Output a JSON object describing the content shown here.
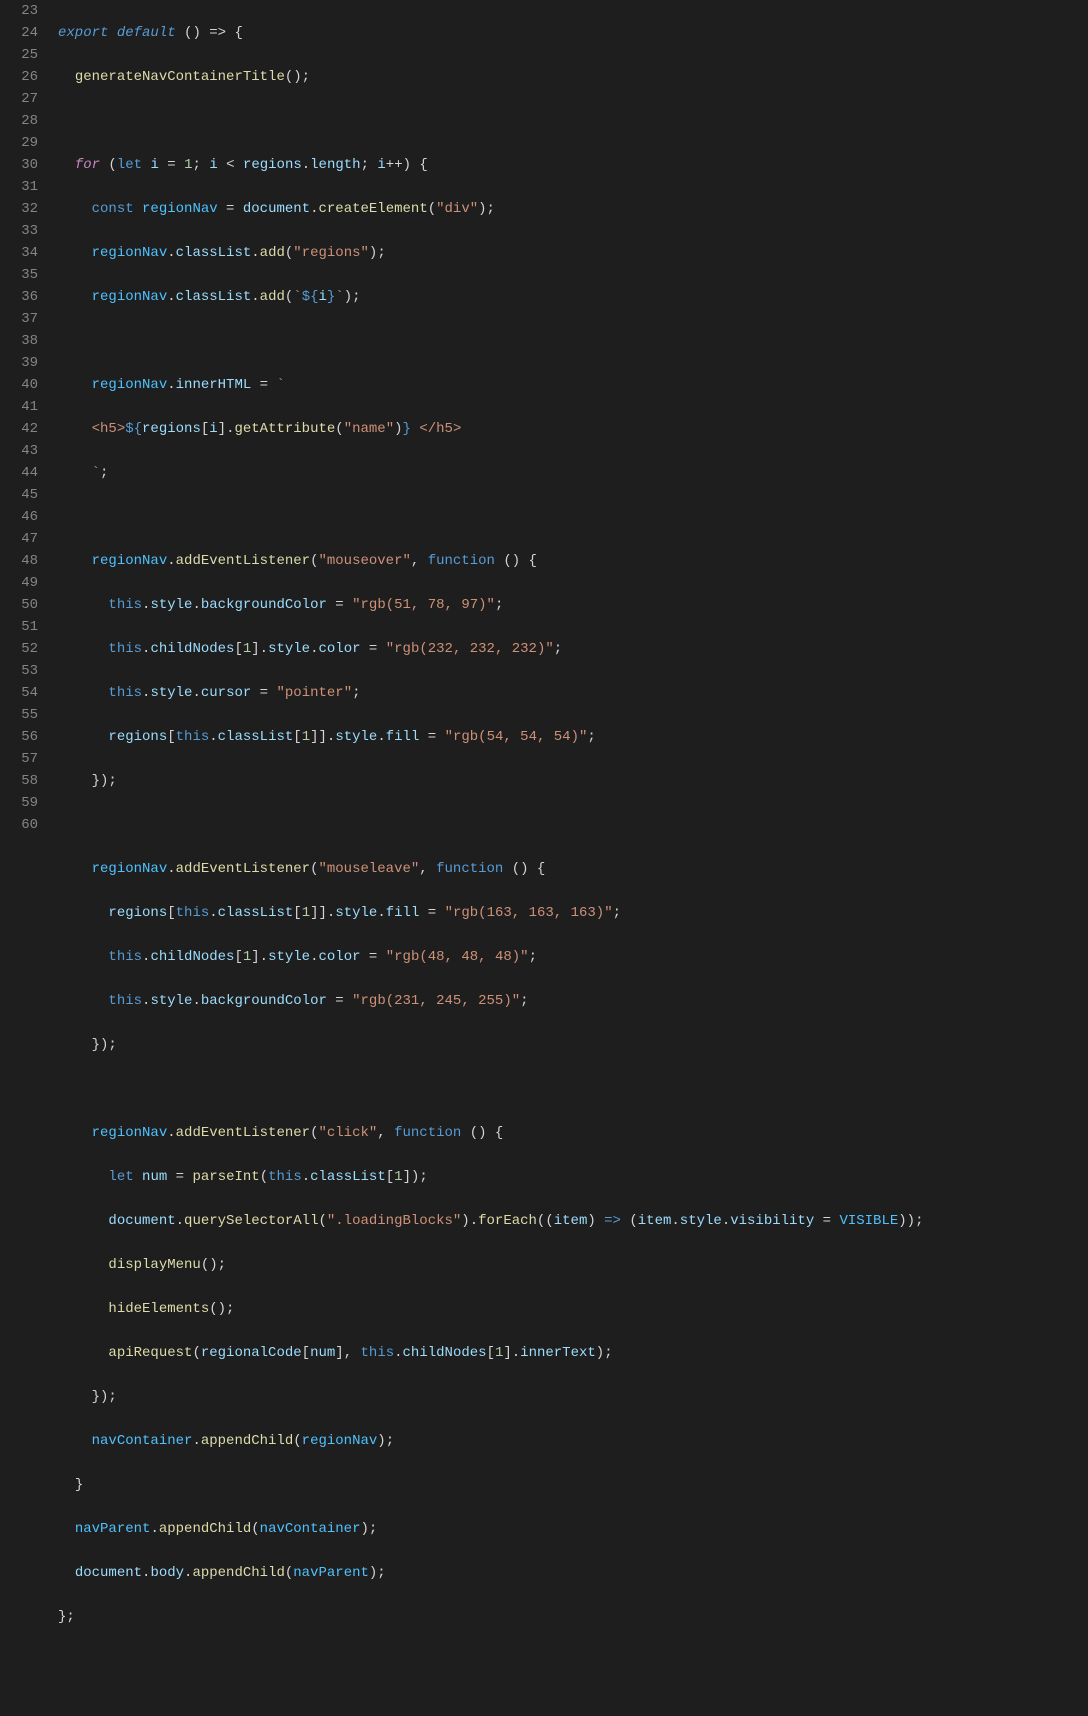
{
  "lineStart": 23,
  "lineEnd": 60,
  "code": {
    "l23": {
      "kw_export": "export",
      "kw_default": "default",
      "arrow": "() => {"
    },
    "l24": {
      "fn": "generateNavContainerTitle",
      "suffix": "();"
    },
    "l26": {
      "for": "for",
      "open": " (",
      "let": "let",
      "i": " i ",
      "eq": "= ",
      "one": "1",
      "semi1": "; ",
      "i2": "i ",
      "lt": "< ",
      "regions": "regions",
      "dot": ".",
      "length": "length",
      "semi2": "; ",
      "i3": "i",
      "pp": "++",
      "close": ") {"
    },
    "l27": {
      "const": "const",
      "sp": " ",
      "regionNav": "regionNav",
      "eq": " = ",
      "document": "document",
      "dot": ".",
      "create": "createElement",
      "open": "(",
      "str": "\"div\"",
      "close": ");"
    },
    "l28": {
      "regionNav": "regionNav",
      "dot1": ".",
      "classList": "classList",
      "dot2": ".",
      "add": "add",
      "open": "(",
      "str": "\"regions\"",
      "close": ");"
    },
    "l29": {
      "regionNav": "regionNav",
      "dot1": ".",
      "classList": "classList",
      "dot2": ".",
      "add": "add",
      "open": "(",
      "bt1": "`",
      "d1": "${",
      "i": "i",
      "d2": "}",
      "bt2": "`",
      "close": ");"
    },
    "l31": {
      "regionNav": "regionNav",
      "dot": ".",
      "innerHTML": "innerHTML",
      "eq": " = ",
      "bt": "`"
    },
    "l32": {
      "h5o": "<h5>",
      "d1": "${",
      "regions": "regions",
      "br1": "[",
      "i": "i",
      "br2": "]",
      "dot": ".",
      "getAttr": "getAttribute",
      "open": "(",
      "str": "\"name\"",
      "close": ")",
      "d2": "}",
      "h5c": " </h5>"
    },
    "l33": {
      "bt": "`",
      ";": ";"
    },
    "l35": {
      "regionNav": "regionNav",
      "dot": ".",
      "add": "addEventListener",
      "open": "(",
      "str": "\"mouseover\"",
      "comma": ", ",
      "function": "function",
      "paren": " () {"
    },
    "l36": {
      "this": "this",
      "d1": ".",
      "style": "style",
      "d2": ".",
      "bg": "backgroundColor",
      "eq": " = ",
      "str": "\"rgb(51, 78, 97)\"",
      "semi": ";"
    },
    "l37": {
      "this": "this",
      "d1": ".",
      "childNodes": "childNodes",
      "br1": "[",
      "one": "1",
      "br2": "]",
      "d2": ".",
      "style": "style",
      "d3": ".",
      "color": "color",
      "eq": " = ",
      "str": "\"rgb(232, 232, 232)\"",
      "semi": ";"
    },
    "l38": {
      "this": "this",
      "d1": ".",
      "style": "style",
      "d2": ".",
      "cursor": "cursor",
      "eq": " = ",
      "str": "\"pointer\"",
      "semi": ";"
    },
    "l39": {
      "regions": "regions",
      "br1": "[",
      "this": "this",
      "d1": ".",
      "classList": "classList",
      "br2": "[",
      "one": "1",
      "br3": "]]",
      "d2": ".",
      "style": "style",
      "d3": ".",
      "fill": "fill",
      "eq": " = ",
      "str": "\"rgb(54, 54, 54)\"",
      "semi": ";"
    },
    "l40": {
      "close": "});"
    },
    "l42": {
      "regionNav": "regionNav",
      "dot": ".",
      "add": "addEventListener",
      "open": "(",
      "str": "\"mouseleave\"",
      "comma": ", ",
      "function": "function",
      "paren": " () {"
    },
    "l43": {
      "regions": "regions",
      "br1": "[",
      "this": "this",
      "d1": ".",
      "classList": "classList",
      "br2": "[",
      "one": "1",
      "br3": "]]",
      "d2": ".",
      "style": "style",
      "d3": ".",
      "fill": "fill",
      "eq": " = ",
      "str": "\"rgb(163, 163, 163)\"",
      "semi": ";"
    },
    "l44": {
      "this": "this",
      "d1": ".",
      "childNodes": "childNodes",
      "br1": "[",
      "one": "1",
      "br2": "]",
      "d2": ".",
      "style": "style",
      "d3": ".",
      "color": "color",
      "eq": " = ",
      "str": "\"rgb(48, 48, 48)\"",
      "semi": ";"
    },
    "l45": {
      "this": "this",
      "d1": ".",
      "style": "style",
      "d2": ".",
      "bg": "backgroundColor",
      "eq": " = ",
      "str": "\"rgb(231, 245, 255)\"",
      "semi": ";"
    },
    "l46": {
      "close": "});"
    },
    "l48": {
      "regionNav": "regionNav",
      "dot": ".",
      "add": "addEventListener",
      "open": "(",
      "str": "\"click\"",
      "comma": ", ",
      "function": "function",
      "paren": " () {"
    },
    "l49": {
      "let": "let",
      "sp": " ",
      "num": "num",
      "eq": " = ",
      "parseInt": "parseInt",
      "open": "(",
      "this": "this",
      "d1": ".",
      "classList": "classList",
      "br1": "[",
      "one": "1",
      "br2": "]",
      "close": ");"
    },
    "l50": {
      "document": "document",
      "d1": ".",
      "qsa": "querySelectorAll",
      "open": "(",
      "str": "\".loadingBlocks\"",
      "close": ")",
      "d2": ".",
      "forEach": "forEach",
      "open2": "((",
      "item": "item",
      "close2": ") ",
      "arrow": "=>",
      "sp": " (",
      "item2": "item",
      "d3": ".",
      "style": "style",
      "d4": ".",
      "vis": "visibility",
      "eq": " = ",
      "VISIBLE": "VISIBLE",
      "close3": "));"
    },
    "l51": {
      "fn": "displayMenu",
      "suffix": "();"
    },
    "l52": {
      "fn": "hideElements",
      "suffix": "();"
    },
    "l53": {
      "fn": "apiRequest",
      "open": "(",
      "regionalCode": "regionalCode",
      "br1": "[",
      "num": "num",
      "br2": "]",
      "comma": ", ",
      "this": "this",
      "d1": ".",
      "childNodes": "childNodes",
      "br3": "[",
      "one": "1",
      "br4": "]",
      "d2": ".",
      "innerText": "innerText",
      "close": ");"
    },
    "l54": {
      "close": "});"
    },
    "l55": {
      "navContainer": "navContainer",
      "d1": ".",
      "appendChild": "appendChild",
      "open": "(",
      "regionNav": "regionNav",
      "close": ");"
    },
    "l56": {
      "close": "}"
    },
    "l57": {
      "navParent": "navParent",
      "d1": ".",
      "appendChild": "appendChild",
      "open": "(",
      "navContainer": "navContainer",
      "close": ");"
    },
    "l58": {
      "document": "document",
      "d1": ".",
      "body": "body",
      "d2": ".",
      "appendChild": "appendChild",
      "open": "(",
      "navParent": "navParent",
      "close": ");"
    },
    "l59": {
      "close": "};"
    }
  }
}
